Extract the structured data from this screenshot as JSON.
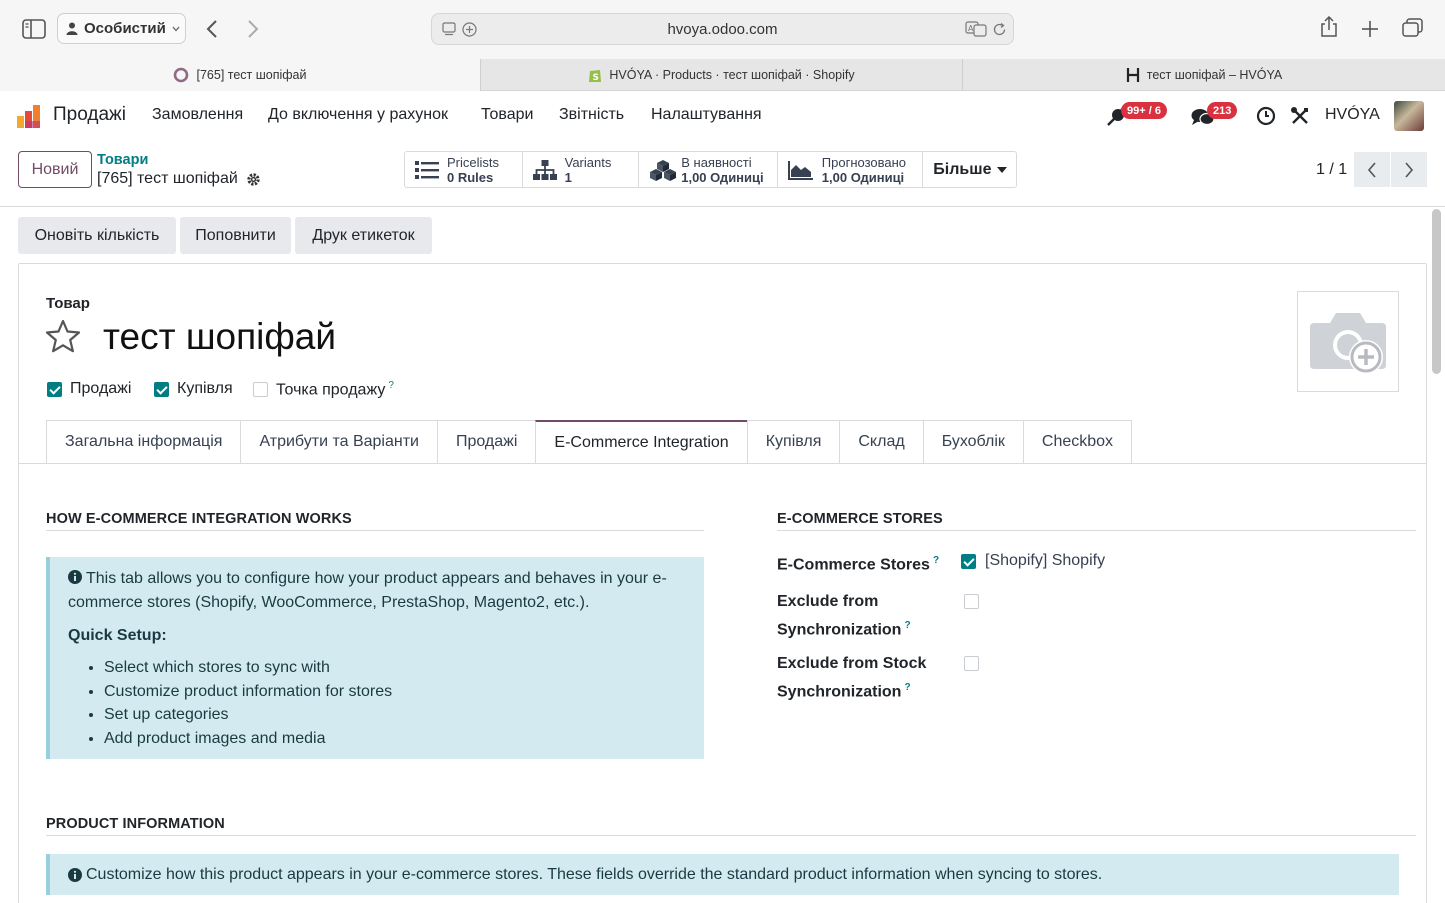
{
  "browser": {
    "profile": "Особистий",
    "url": "hvoya.odoo.com",
    "tabs": [
      {
        "title": "[765] тест шопіфай"
      },
      {
        "title": "HVÓYA · Products · тест шопіфай · Shopify"
      },
      {
        "title": "тест шопіфай – HVÓYA"
      }
    ]
  },
  "navbar": {
    "app_name": "Продажі",
    "menu": [
      "Замовлення",
      "До включення у рахунок",
      "Товари",
      "Звітність",
      "Налаштування"
    ],
    "activity_badge": "99+ / 6",
    "messages_badge": "213",
    "company": "HVÓYA"
  },
  "control_panel": {
    "new_button": "Новий",
    "breadcrumb_parent": "Товари",
    "record_title": "[765] тест шопіфай",
    "smart_buttons": [
      {
        "label": "Pricelists",
        "value": "0 Rules",
        "icon": "list-icon"
      },
      {
        "label": "Variants",
        "value": "1",
        "icon": "sitemap-icon"
      },
      {
        "label": "В наявності",
        "value": "1,00 Одиниці",
        "icon": "cubes-icon"
      },
      {
        "label": "Прогнозовано",
        "value": "1,00 Одиниці",
        "icon": "area-chart-icon"
      }
    ],
    "more_button": "Більше",
    "pager": "1 / 1"
  },
  "actions": [
    "Оновіть кількість",
    "Поповнити",
    "Друк етикеток"
  ],
  "form": {
    "product_type_label": "Товар",
    "product_name": "тест шопіфай",
    "flags": [
      {
        "label": "Продажі",
        "checked": true
      },
      {
        "label": "Купівля",
        "checked": true
      },
      {
        "label": "Точка продажу",
        "checked": false,
        "help": "?"
      }
    ],
    "tabs": [
      "Загальна інформація",
      "Атрибути та Варіанти",
      "Продажі",
      "E-Commerce Integration",
      "Купівля",
      "Склад",
      "Бухоблік",
      "Checkbox"
    ],
    "active_tab": "E-Commerce Integration",
    "how_section": {
      "title": "HOW E-COMMERCE INTEGRATION WORKS",
      "intro": "This tab allows you to configure how your product appears and behaves in your e-commerce stores (Shopify, WooCommerce, PrestaShop, Magento2, etc.).",
      "quick_setup": "Quick Setup:",
      "steps": [
        "Select which stores to sync with",
        "Customize product information for stores",
        "Set up categories",
        "Add product images and media"
      ]
    },
    "stores_section": {
      "title": "E-COMMERCE STORES",
      "stores_label": "E-Commerce Stores",
      "stores_value": "[Shopify] Shopify",
      "stores_checked": true,
      "exclude_sync_label_1": "Exclude from",
      "exclude_sync_label_2": "Synchronization",
      "exclude_sync_checked": false,
      "exclude_stock_label_1": "Exclude from Stock",
      "exclude_stock_label_2": "Synchronization",
      "exclude_stock_checked": false,
      "help": "?"
    },
    "product_info_section": {
      "title": "PRODUCT INFORMATION",
      "note": "Customize how this product appears in your e-commerce stores. These fields override the standard product information when syncing to stores."
    }
  }
}
